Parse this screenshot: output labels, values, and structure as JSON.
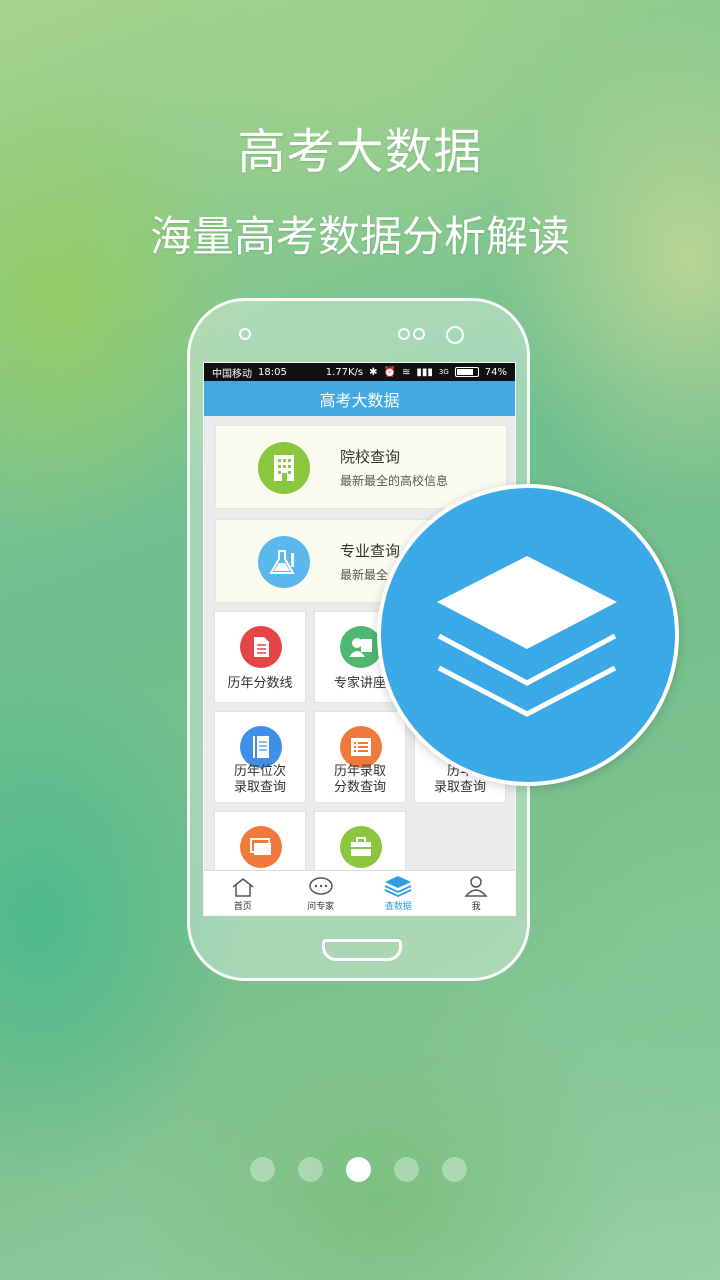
{
  "headline": {
    "title": "高考大数据",
    "subtitle": "海量高考数据分析解读"
  },
  "statusbar": {
    "carrier": "中国移动",
    "time": "18:05",
    "speed": "1.77K/s",
    "network": "3G",
    "battery": "74%"
  },
  "app": {
    "title": "高考大数据"
  },
  "cards": [
    {
      "title": "院校查询",
      "desc": "最新最全的高校信息",
      "icon": "building-icon",
      "color": "#8cc63f"
    },
    {
      "title": "专业查询",
      "desc": "最新最全",
      "icon": "flask-icon",
      "color": "#5bb8ec"
    }
  ],
  "tiles": [
    {
      "label": "历年分数线",
      "icon": "document-icon",
      "color": "#e64545"
    },
    {
      "label": "专家讲座",
      "icon": "expert-icon",
      "color": "#4fb870"
    },
    {
      "line1": "历年位次",
      "line2": "录取查询",
      "icon": "book-icon",
      "color": "#3f8fe8"
    },
    {
      "line1": "历年录取",
      "line2": "分数查询",
      "icon": "list-icon",
      "color": "#f07a3c"
    },
    {
      "line1": "历年",
      "line2": "录取查询",
      "icon": "partial-icon",
      "color": "#3f8fe8"
    },
    {
      "label": "",
      "icon": "cards-icon",
      "color": "#f07a3c"
    },
    {
      "label": "",
      "icon": "toolbox-icon",
      "color": "#8cc63f"
    }
  ],
  "tabbar": [
    {
      "label": "首页",
      "icon": "home-icon",
      "active": false
    },
    {
      "label": "问专家",
      "icon": "chat-icon",
      "active": false
    },
    {
      "label": "查数据",
      "icon": "layers-icon",
      "active": true
    },
    {
      "label": "我",
      "icon": "user-icon",
      "active": false
    }
  ],
  "feature_badge": {
    "icon": "layers-icon",
    "color": "#3aa9e6"
  },
  "pager": {
    "total": 5,
    "current": 3
  }
}
